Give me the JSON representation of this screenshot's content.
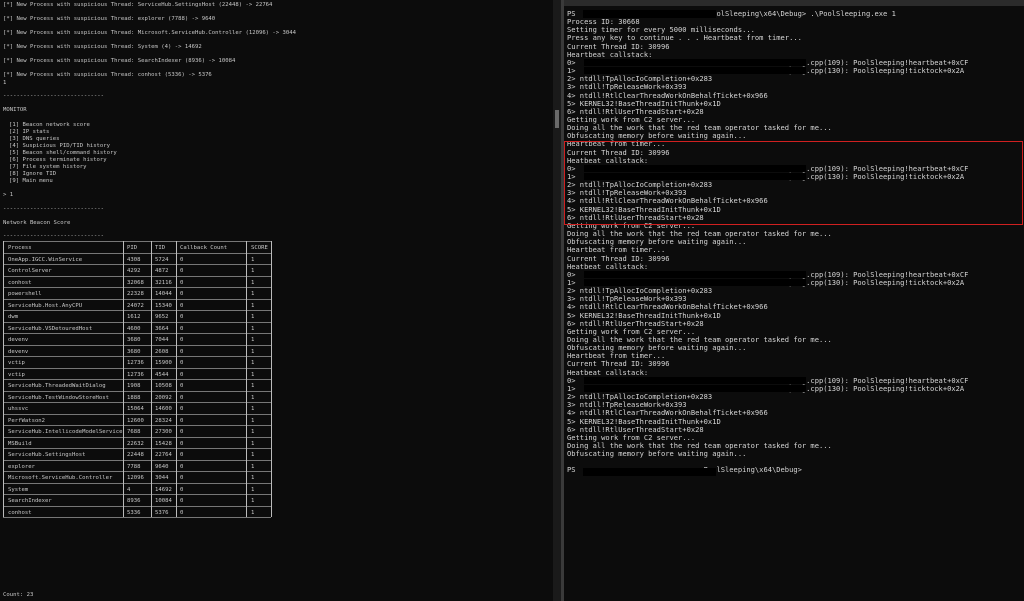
{
  "monitor_console": {
    "event_lines": [
      "[*] New Process with suspicious Thread: ServiceHub.SettingsHost (22448) -> 22764",
      "[*] New Process with suspicious Thread: explorer (7788) -> 9640",
      "[*] New Process with suspicious Thread: Microsoft.ServiceHub.Controller (12096) -> 3044",
      "[*] New Process with suspicious Thread: System (4) -> 14692",
      "[*] New Process with suspicious Thread: SearchIndexer (8936) -> 10084",
      "[*] New Process with suspicious Thread: conhost (5336) -> 5376"
    ],
    "input_echo": "1",
    "separator": "------------------------------",
    "menu_title": "MONITOR",
    "menu_items": [
      "[1] Beacon network score",
      "[2] IP stats",
      "[3] DNS queries",
      "[4] Suspicious PID/TID history",
      "[5] Beacon shell/command history",
      "[6] Process terminate history",
      "[7] File system history",
      "[8] Ignore TID",
      "[9] Main menu"
    ],
    "prompt": "> 1",
    "score_title": "Network Beacon Score",
    "score_rule": "------------------------------",
    "table_headers": [
      "Process",
      "PID",
      "TID",
      "Callback Count",
      "SCORE"
    ],
    "table_rows": [
      [
        "OneApp.IGCC.WinService",
        "4308",
        "5724",
        "0",
        "1"
      ],
      [
        "ControlServer",
        "4292",
        "4872",
        "0",
        "1"
      ],
      [
        "conhost",
        "32068",
        "32116",
        "0",
        "1"
      ],
      [
        "powershell",
        "22328",
        "14044",
        "0",
        "1"
      ],
      [
        "ServiceHub.Host.AnyCPU",
        "24072",
        "15340",
        "0",
        "1"
      ],
      [
        "dwm",
        "1612",
        "9652",
        "0",
        "1"
      ],
      [
        "ServiceHub.VSDetouredHost",
        "4600",
        "3664",
        "0",
        "1"
      ],
      [
        "devenv",
        "3680",
        "7044",
        "0",
        "1"
      ],
      [
        "devenv",
        "3680",
        "2608",
        "0",
        "1"
      ],
      [
        "vctip",
        "12736",
        "15900",
        "0",
        "1"
      ],
      [
        "vctip",
        "12736",
        "4544",
        "0",
        "1"
      ],
      [
        "ServiceHub.ThreadedWaitDialog",
        "1908",
        "10508",
        "0",
        "1"
      ],
      [
        "ServiceHub.TestWindowStoreHost",
        "1888",
        "20092",
        "0",
        "1"
      ],
      [
        "uhssvc",
        "15064",
        "14600",
        "0",
        "1"
      ],
      [
        "PerfWatson2",
        "12600",
        "28324",
        "0",
        "1"
      ],
      [
        "ServiceHub.IntellicodeModelService",
        "7688",
        "27300",
        "0",
        "1"
      ],
      [
        "MSBuild",
        "22632",
        "15428",
        "0",
        "1"
      ],
      [
        "ServiceHub.SettingsHost",
        "22448",
        "22764",
        "0",
        "1"
      ],
      [
        "explorer",
        "7788",
        "9640",
        "0",
        "1"
      ],
      [
        "Microsoft.ServiceHub.Controller",
        "12096",
        "3044",
        "0",
        "1"
      ],
      [
        "System",
        "4",
        "14692",
        "0",
        "1"
      ],
      [
        "SearchIndexer",
        "8936",
        "10084",
        "0",
        "1"
      ],
      [
        "conhost",
        "5336",
        "5376",
        "0",
        "1"
      ]
    ],
    "count_label": "Count: 23"
  },
  "powershell": {
    "lines": [
      "PS                              \\PoolSleeping\\x64\\Debug> .\\PoolSleeping.exe 1",
      "Process ID: 30668",
      "Setting timer for every 5000 milliseconds...",
      "Press any key to continue . . . Heartbeat from timer...",
      "Current Thread ID: 30996",
      "Heartbeat callstack:",
      "0>                                          PoolSleeping.cpp(109): PoolSleeping!heartbeat+0xCF",
      "1>                                          PoolSleeping.cpp(130): PoolSleeping!ticktock+0x2A",
      "2> ntdll!TpAllocIoCompletion+0x283",
      "3> ntdll!TpReleaseWork+0x393",
      "4> ntdll!RtlClearThreadWorkOnBehalfTicket+0x966",
      "5> KERNEL32!BaseThreadInitThunk+0x1D",
      "6> ntdll!RtlUserThreadStart+0x28",
      "Getting work from C2 server...",
      "Doing all the work that the red team operator tasked for me...",
      "Obfuscating memory before waiting again...",
      "Heartbeat from timer...",
      "Current Thread ID: 30996",
      "Heatbeat callstack:",
      "0>                                          PoolSleeping.cpp(109): PoolSleeping!heartbeat+0xCF",
      "1>                                          PoolSleeping.cpp(130): PoolSleeping!ticktock+0x2A",
      "2> ntdll!TpAllocIoCompletion+0x283",
      "3> ntdll!TpReleaseWork+0x393",
      "4> ntdll!RtlClearThreadWorkOnBehalfTicket+0x966",
      "5> KERNEL32!BaseThreadInitThunk+0x1D",
      "6> ntdll!RtlUserThreadStart+0x28",
      "Getting work from C2 server...",
      "Doing all the work that the red team operator tasked for me...",
      "Obfuscating memory before waiting again...",
      "Heartbeat from timer...",
      "Current Thread ID: 30996",
      "Heatbeat callstack:",
      "0>                                          PoolSleeping.cpp(109): PoolSleeping!heartbeat+0xCF",
      "1>                                          PoolSleeping.cpp(130): PoolSleeping!ticktock+0x2A",
      "2> ntdll!TpAllocIoCompletion+0x283",
      "3> ntdll!TpReleaseWork+0x393",
      "4> ntdll!RtlClearThreadWorkOnBehalfTicket+0x966",
      "5> KERNEL32!BaseThreadInitThunk+0x1D",
      "6> ntdll!RtlUserThreadStart+0x28",
      "Getting work from C2 server...",
      "Doing all the work that the red team operator tasked for me...",
      "Obfuscating memory before waiting again...",
      "Heartbeat from timer...",
      "Current Thread ID: 30996",
      "Heatbeat callstack:",
      "0>                                          PoolSleeping.cpp(109): PoolSleeping!heartbeat+0xCF",
      "1>                                          PoolSleeping.cpp(130): PoolSleeping!ticktock+0x2A",
      "2> ntdll!TpAllocIoCompletion+0x283",
      "3> ntdll!TpReleaseWork+0x393",
      "4> ntdll!RtlClearThreadWorkOnBehalfTicket+0x966",
      "5> KERNEL32!BaseThreadInitThunk+0x1D",
      "6> ntdll!RtlUserThreadStart+0x28",
      "Getting work from C2 server...",
      "Doing all the work that the red team operator tasked for me...",
      "Obfuscating memory before waiting again...",
      "",
      "PS                              PoolSleeping\\x64\\Debug>"
    ]
  },
  "colors": {
    "background": "#0c0c0c",
    "text": "#d6d6d6",
    "highlight_border": "#d02020"
  }
}
